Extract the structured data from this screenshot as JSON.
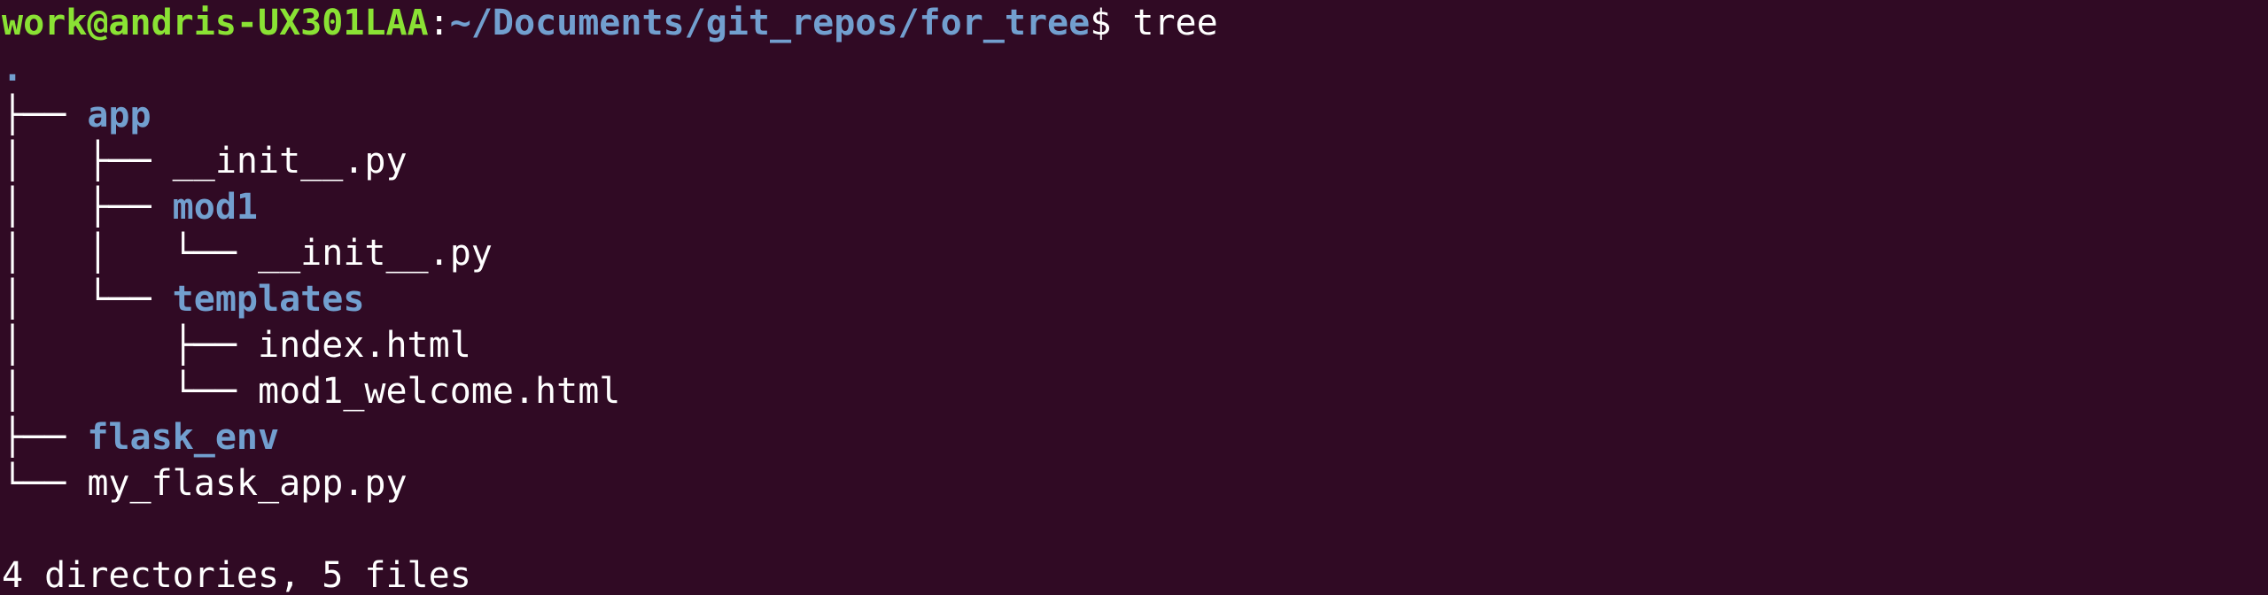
{
  "prompt": {
    "user_host": "work@andris-UX301LAA",
    "separator": ":",
    "path": "~/Documents/git_repos/for_tree",
    "symbol": "$",
    "command": " tree"
  },
  "tree": [
    {
      "prefix": "",
      "name": ".",
      "type": "dir"
    },
    {
      "prefix": "├── ",
      "name": "app",
      "type": "dir"
    },
    {
      "prefix": "│   ├── ",
      "name": "__init__.py",
      "type": "file"
    },
    {
      "prefix": "│   ├── ",
      "name": "mod1",
      "type": "dir"
    },
    {
      "prefix": "│   │   └── ",
      "name": "__init__.py",
      "type": "file"
    },
    {
      "prefix": "│   └── ",
      "name": "templates",
      "type": "dir"
    },
    {
      "prefix": "│       ├── ",
      "name": "index.html",
      "type": "file"
    },
    {
      "prefix": "│       └── ",
      "name": "mod1_welcome.html",
      "type": "file"
    },
    {
      "prefix": "├── ",
      "name": "flask_env",
      "type": "dir"
    },
    {
      "prefix": "└── ",
      "name": "my_flask_app.py",
      "type": "file"
    }
  ],
  "summary": "4 directories, 5 files",
  "colors": {
    "background": "#300a24",
    "user_host": "#8ae234",
    "path": "#729fcf",
    "directory": "#729fcf",
    "file": "#ffffff"
  }
}
